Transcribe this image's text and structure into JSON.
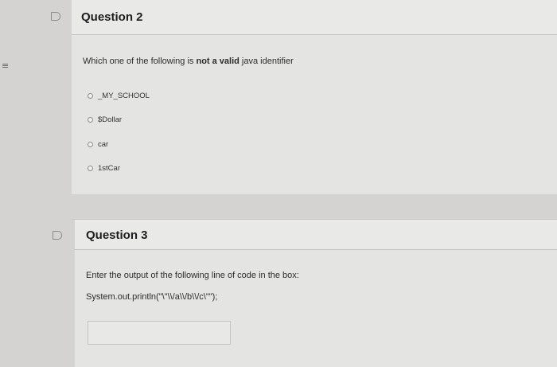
{
  "sidebar_mark": "≡",
  "question2": {
    "title": "Question 2",
    "prompt_before": "Which one of the following is ",
    "prompt_bold": "not a valid",
    "prompt_after": " java identifier",
    "options": [
      "_MY_SCHOOL",
      "$Dollar",
      "car",
      "1stCar"
    ]
  },
  "question3": {
    "title": "Question 3",
    "prompt": "Enter the output of the following line of code in the box:",
    "code": "System.out.println(\"\\\"\\\\/a\\\\/b\\\\/c\\\"\");",
    "answer_value": ""
  },
  "colors": {
    "background": "#d4d3d1",
    "header": "#e9e9e8",
    "body": "#e4e4e2"
  },
  "icons": [
    "flag-icon",
    "radio-button-icon"
  ]
}
